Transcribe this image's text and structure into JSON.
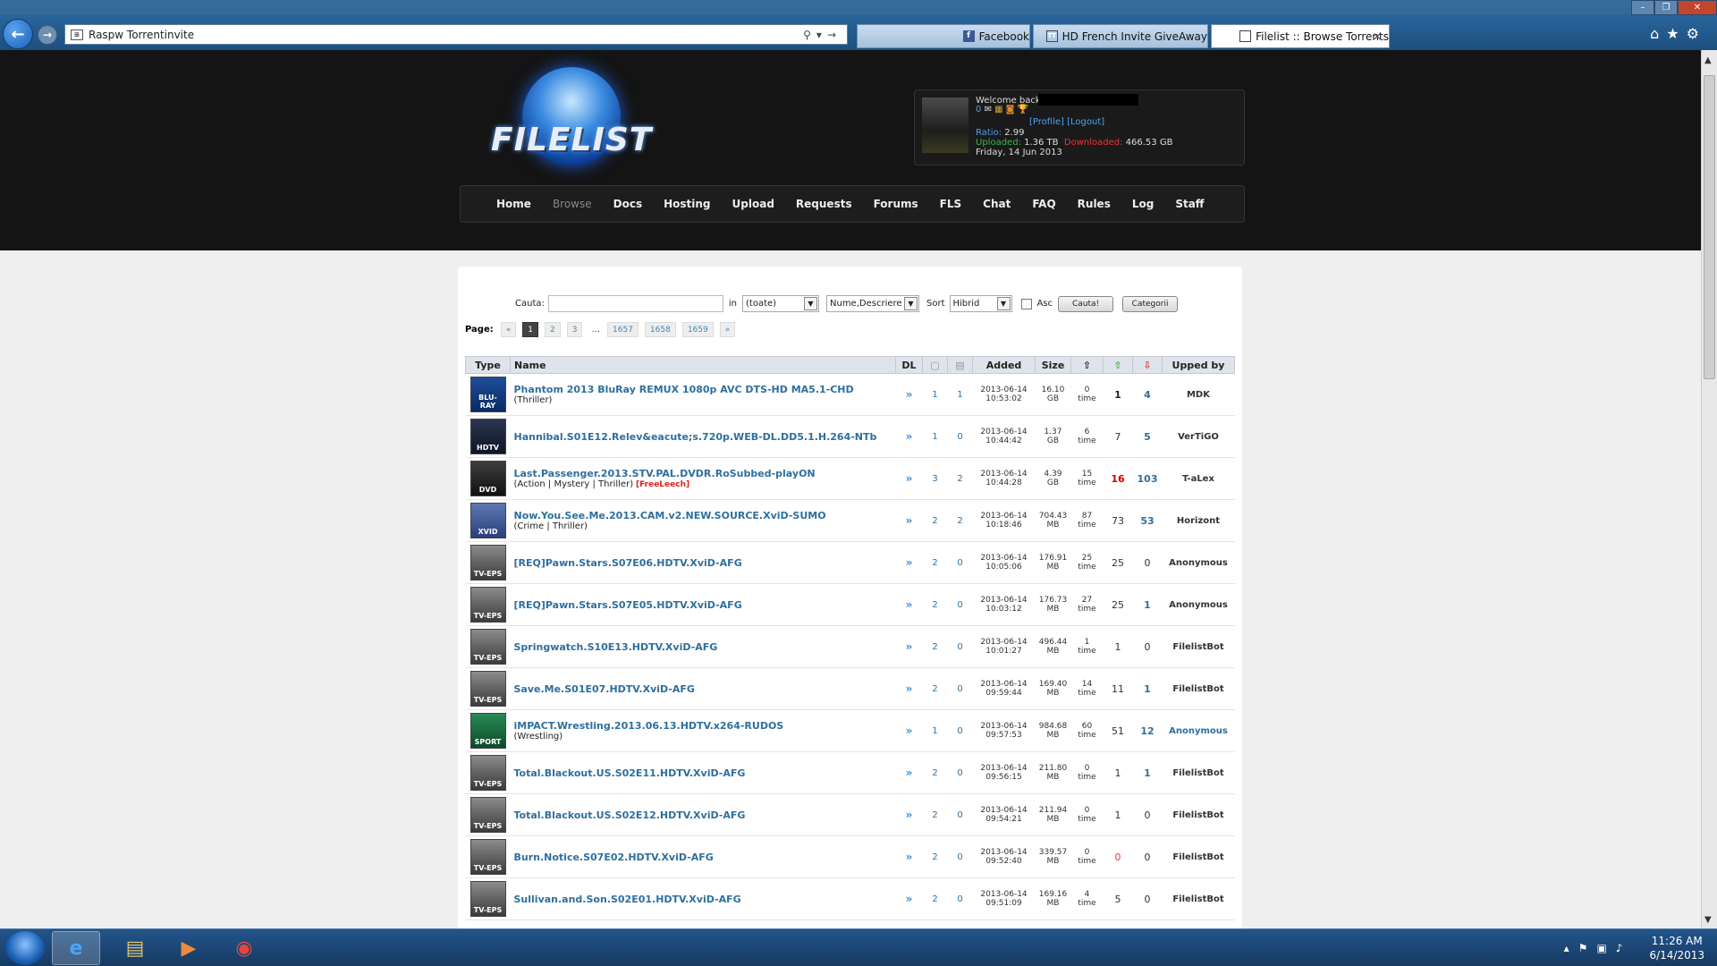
{
  "browser": {
    "address": "Raspw Torrentinvite",
    "tabs": [
      {
        "label": "Facebook",
        "icon": "f"
      },
      {
        "label": "HD French Invite GiveAway",
        "icon": "TT"
      },
      {
        "label": "Filelist :: Browse Torrents",
        "icon": "FL"
      }
    ]
  },
  "site": {
    "logo": "FILELIST",
    "user": {
      "welcome": "Welcome back",
      "icons_count": "0",
      "profile": "[Profile]",
      "logout": "[Logout]",
      "ratio_label": "Ratio:",
      "ratio_value": "2.99",
      "uploaded_label": "Uploaded:",
      "uploaded_value": "1.36 TB",
      "downloaded_label": "Downloaded:",
      "downloaded_value": "466.53 GB",
      "date": "Friday, 14 Jun 2013"
    },
    "nav": [
      "Home",
      "Browse",
      "Docs",
      "Hosting",
      "Upload",
      "Requests",
      "Forums",
      "FLS",
      "Chat",
      "FAQ",
      "Rules",
      "Log",
      "Staff"
    ]
  },
  "search": {
    "label": "Cauta:",
    "in_label": "in",
    "category_value": "(toate)",
    "field_value": "Nume,Descriere",
    "sort_label": "Sort",
    "sort_value": "Hibrid",
    "asc_label": "Asc",
    "search_button": "Cauta!",
    "categories_button": "Categorii"
  },
  "pager": {
    "label": "Page:",
    "prev": "«",
    "pages": [
      "1",
      "2",
      "3"
    ],
    "ellipsis": "...",
    "last_pages": [
      "1657",
      "1658",
      "1659"
    ],
    "next": "»"
  },
  "table": {
    "headers": {
      "type": "Type",
      "name": "Name",
      "dl": "DL",
      "added": "Added",
      "size": "Size",
      "upped": "Upped by"
    },
    "rows": [
      {
        "icon": "bluray",
        "icon_label": "BLU-RAY",
        "name": "Phantom 2013 BluRay REMUX 1080p AVC DTS-HD MA5.1-CHD",
        "genre": "(Thriller)",
        "freeleech": "",
        "files": "1",
        "comments": "1",
        "date": "2013-06-14",
        "time": "10:53:02",
        "size": "16.10",
        "unit": "GB",
        "snatched": "0",
        "snatched_unit": "time",
        "seeders": "1",
        "seed_style": "bold",
        "leechers": "4",
        "leech_style": "",
        "upper": "MDK",
        "upper_style": ""
      },
      {
        "icon": "hdtv",
        "icon_label": "HDTV",
        "name": "Hannibal.S01E12.Relev&eacute;s.720p.WEB-DL.DD5.1.H.264-NTb",
        "genre": "",
        "freeleech": "",
        "files": "1",
        "comments": "0",
        "date": "2013-06-14",
        "time": "10:44:42",
        "size": "1.37",
        "unit": "GB",
        "snatched": "6",
        "snatched_unit": "time",
        "seeders": "7",
        "seed_style": "",
        "leechers": "5",
        "leech_style": "",
        "upper": "VerTiGO",
        "upper_style": ""
      },
      {
        "icon": "dvd",
        "icon_label": "DVD",
        "name": "Last.Passenger.2013.STV.PAL.DVDR.RoSubbed-playON",
        "genre": "(Action | Mystery | Thriller)",
        "freeleech": "[FreeLeech]",
        "files": "3",
        "comments": "2",
        "date": "2013-06-14",
        "time": "10:44:28",
        "size": "4.39",
        "unit": "GB",
        "snatched": "15",
        "snatched_unit": "time",
        "seeders": "16",
        "seed_style": "red",
        "leechers": "103",
        "leech_style": "",
        "upper": "T-aLex",
        "upper_style": ""
      },
      {
        "icon": "xvid",
        "icon_label": "XVID",
        "name": "Now.You.See.Me.2013.CAM.v2.NEW.SOURCE.XviD-SUMO",
        "genre": "(Crime | Thriller)",
        "freeleech": "",
        "files": "2",
        "comments": "2",
        "date": "2013-06-14",
        "time": "10:18:46",
        "size": "704.43",
        "unit": "MB",
        "snatched": "87",
        "snatched_unit": "time",
        "seeders": "73",
        "seed_style": "",
        "leechers": "53",
        "leech_style": "",
        "upper": "Horizont",
        "upper_style": ""
      },
      {
        "icon": "tveps",
        "icon_label": "TV-EPS",
        "name": "[REQ]Pawn.Stars.S07E06.HDTV.XviD-AFG",
        "genre": "",
        "freeleech": "",
        "files": "2",
        "comments": "0",
        "date": "2013-06-14",
        "time": "10:05:06",
        "size": "176.91",
        "unit": "MB",
        "snatched": "25",
        "snatched_unit": "time",
        "seeders": "25",
        "seed_style": "",
        "leechers": "0",
        "leech_style": "plain",
        "upper": "Anonymous",
        "upper_style": ""
      },
      {
        "icon": "tveps",
        "icon_label": "TV-EPS",
        "name": "[REQ]Pawn.Stars.S07E05.HDTV.XviD-AFG",
        "genre": "",
        "freeleech": "",
        "files": "2",
        "comments": "0",
        "date": "2013-06-14",
        "time": "10:03:12",
        "size": "176.73",
        "unit": "MB",
        "snatched": "27",
        "snatched_unit": "time",
        "seeders": "25",
        "seed_style": "",
        "leechers": "1",
        "leech_style": "",
        "upper": "Anonymous",
        "upper_style": ""
      },
      {
        "icon": "tveps",
        "icon_label": "TV-EPS",
        "name": "Springwatch.S10E13.HDTV.XviD-AFG",
        "genre": "",
        "freeleech": "",
        "files": "2",
        "comments": "0",
        "date": "2013-06-14",
        "time": "10:01:27",
        "size": "496.44",
        "unit": "MB",
        "snatched": "1",
        "snatched_unit": "time",
        "seeders": "1",
        "seed_style": "",
        "leechers": "0",
        "leech_style": "plain",
        "upper": "FilelistBot",
        "upper_style": ""
      },
      {
        "icon": "tveps",
        "icon_label": "TV-EPS",
        "name": "Save.Me.S01E07.HDTV.XviD-AFG",
        "genre": "",
        "freeleech": "",
        "files": "2",
        "comments": "0",
        "date": "2013-06-14",
        "time": "09:59:44",
        "size": "169.40",
        "unit": "MB",
        "snatched": "14",
        "snatched_unit": "time",
        "seeders": "11",
        "seed_style": "",
        "leechers": "1",
        "leech_style": "",
        "upper": "FilelistBot",
        "upper_style": ""
      },
      {
        "icon": "sport",
        "icon_label": "SPORT",
        "name": "iMPACT.Wrestling.2013.06.13.HDTV.x264-RUDOS",
        "genre": "(Wrestling)",
        "freeleech": "",
        "files": "1",
        "comments": "0",
        "date": "2013-06-14",
        "time": "09:57:53",
        "size": "984.68",
        "unit": "MB",
        "snatched": "60",
        "snatched_unit": "time",
        "seeders": "51",
        "seed_style": "",
        "leechers": "12",
        "leech_style": "",
        "upper": "Anonymous",
        "upper_style": "blue"
      },
      {
        "icon": "tveps",
        "icon_label": "TV-EPS",
        "name": "Total.Blackout.US.S02E11.HDTV.XviD-AFG",
        "genre": "",
        "freeleech": "",
        "files": "2",
        "comments": "0",
        "date": "2013-06-14",
        "time": "09:56:15",
        "size": "211.80",
        "unit": "MB",
        "snatched": "0",
        "snatched_unit": "time",
        "seeders": "1",
        "seed_style": "",
        "leechers": "1",
        "leech_style": "",
        "upper": "FilelistBot",
        "upper_style": ""
      },
      {
        "icon": "tveps",
        "icon_label": "TV-EPS",
        "name": "Total.Blackout.US.S02E12.HDTV.XviD-AFG",
        "genre": "",
        "freeleech": "",
        "files": "2",
        "comments": "0",
        "date": "2013-06-14",
        "time": "09:54:21",
        "size": "211.94",
        "unit": "MB",
        "snatched": "0",
        "snatched_unit": "time",
        "seeders": "1",
        "seed_style": "",
        "leechers": "0",
        "leech_style": "plain",
        "upper": "FilelistBot",
        "upper_style": ""
      },
      {
        "icon": "tveps",
        "icon_label": "TV-EPS",
        "name": "Burn.Notice.S07E02.HDTV.XviD-AFG",
        "genre": "",
        "freeleech": "",
        "files": "2",
        "comments": "0",
        "date": "2013-06-14",
        "time": "09:52:40",
        "size": "339.57",
        "unit": "MB",
        "snatched": "0",
        "snatched_unit": "time",
        "seeders": "0",
        "seed_style": "redl",
        "leechers": "0",
        "leech_style": "plain",
        "upper": "FilelistBot",
        "upper_style": ""
      },
      {
        "icon": "tveps",
        "icon_label": "TV-EPS",
        "name": "Sullivan.and.Son.S02E01.HDTV.XviD-AFG",
        "genre": "",
        "freeleech": "",
        "files": "2",
        "comments": "0",
        "date": "2013-06-14",
        "time": "09:51:09",
        "size": "169.16",
        "unit": "MB",
        "snatched": "4",
        "snatched_unit": "time",
        "seeders": "5",
        "seed_style": "",
        "leechers": "0",
        "leech_style": "plain",
        "upper": "FilelistBot",
        "upper_style": ""
      }
    ]
  },
  "taskbar": {
    "time": "11:26 AM",
    "date": "6/14/2013"
  },
  "colors": {
    "link": "#2e6f9e",
    "header_bg": "#141414",
    "table_head": "#dfe3ea",
    "freeleech": "#d22"
  }
}
